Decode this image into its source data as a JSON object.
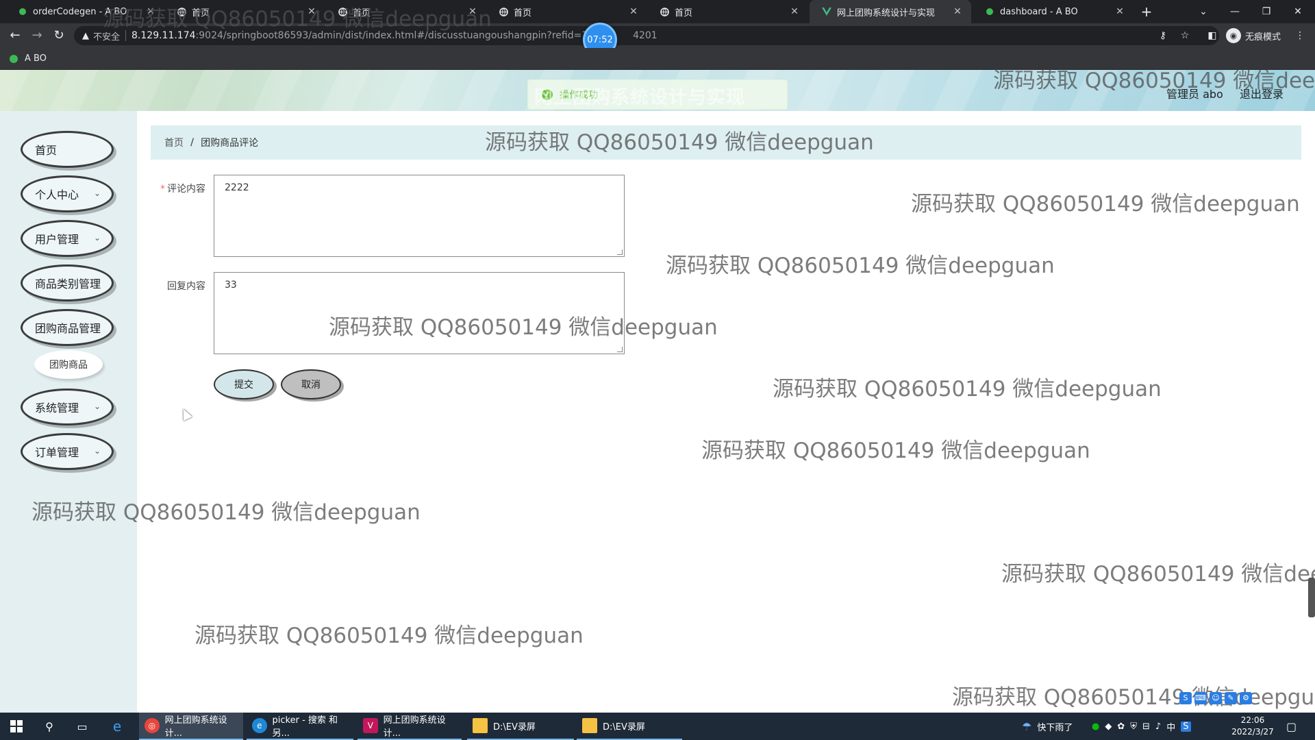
{
  "browser": {
    "tabs": [
      {
        "label": "orderCodegen - A BO",
        "icon": "green-leaf-icon"
      },
      {
        "label": "首页",
        "icon": "globe-icon"
      },
      {
        "label": "首页",
        "icon": "globe-icon"
      },
      {
        "label": "首页",
        "icon": "globe-icon"
      },
      {
        "label": "首页",
        "icon": "globe-icon"
      },
      {
        "label": "网上团购系统设计与实现",
        "icon": "vue-icon"
      },
      {
        "label": "dashboard - A BO",
        "icon": "green-leaf-icon"
      }
    ],
    "address": {
      "insecure_label": "不安全",
      "host": "8.129.11.174",
      "path_left": ":9024/springboot86593/admin/dist/index.html#/discusstuangoushangpin?refid=164",
      "path_right": "4201"
    },
    "recording_timer": "07:52",
    "incognito_label": "无痕模式",
    "bookmark": "A BO"
  },
  "app": {
    "system_title": "网上团购系统设计与实现",
    "toast": "操作成功",
    "user": "管理员 abo",
    "logout": "退出登录"
  },
  "sidebar": {
    "items": [
      {
        "label": "首页",
        "has_submenu": false
      },
      {
        "label": "个人中心",
        "has_submenu": true
      },
      {
        "label": "用户管理",
        "has_submenu": true
      },
      {
        "label": "商品类别管理",
        "has_submenu": false
      },
      {
        "label": "团购商品管理",
        "has_submenu": false
      },
      {
        "label": "系统管理",
        "has_submenu": true
      },
      {
        "label": "订单管理",
        "has_submenu": true
      }
    ],
    "sub_items": [
      {
        "label": "团购商品"
      }
    ]
  },
  "breadcrumb": {
    "home": "首页",
    "separator": "/",
    "current": "团购商品评论"
  },
  "form": {
    "comment_label": "评论内容",
    "comment_required_mark": "*",
    "comment_value": "2222",
    "reply_label": "回复内容",
    "reply_value": "33",
    "submit_label": "提交",
    "cancel_label": "取消"
  },
  "watermark": "源码获取 QQ86050149 微信deepguan",
  "taskbar": {
    "apps": [
      {
        "label": "网上团购系统设计...",
        "icon": "chrome-icon"
      },
      {
        "label": "picker - 搜索 和另...",
        "icon": "edge-icon"
      },
      {
        "label": "网上团购系统设计...",
        "icon": "visual-studio-icon"
      },
      {
        "label": "D:\\EV录屏",
        "icon": "folder-icon"
      },
      {
        "label": "D:\\EV录屏",
        "icon": "folder-icon"
      }
    ],
    "weather": "快下雨了",
    "input_method": "中",
    "time": "22:06",
    "date": "2022/3/27"
  }
}
